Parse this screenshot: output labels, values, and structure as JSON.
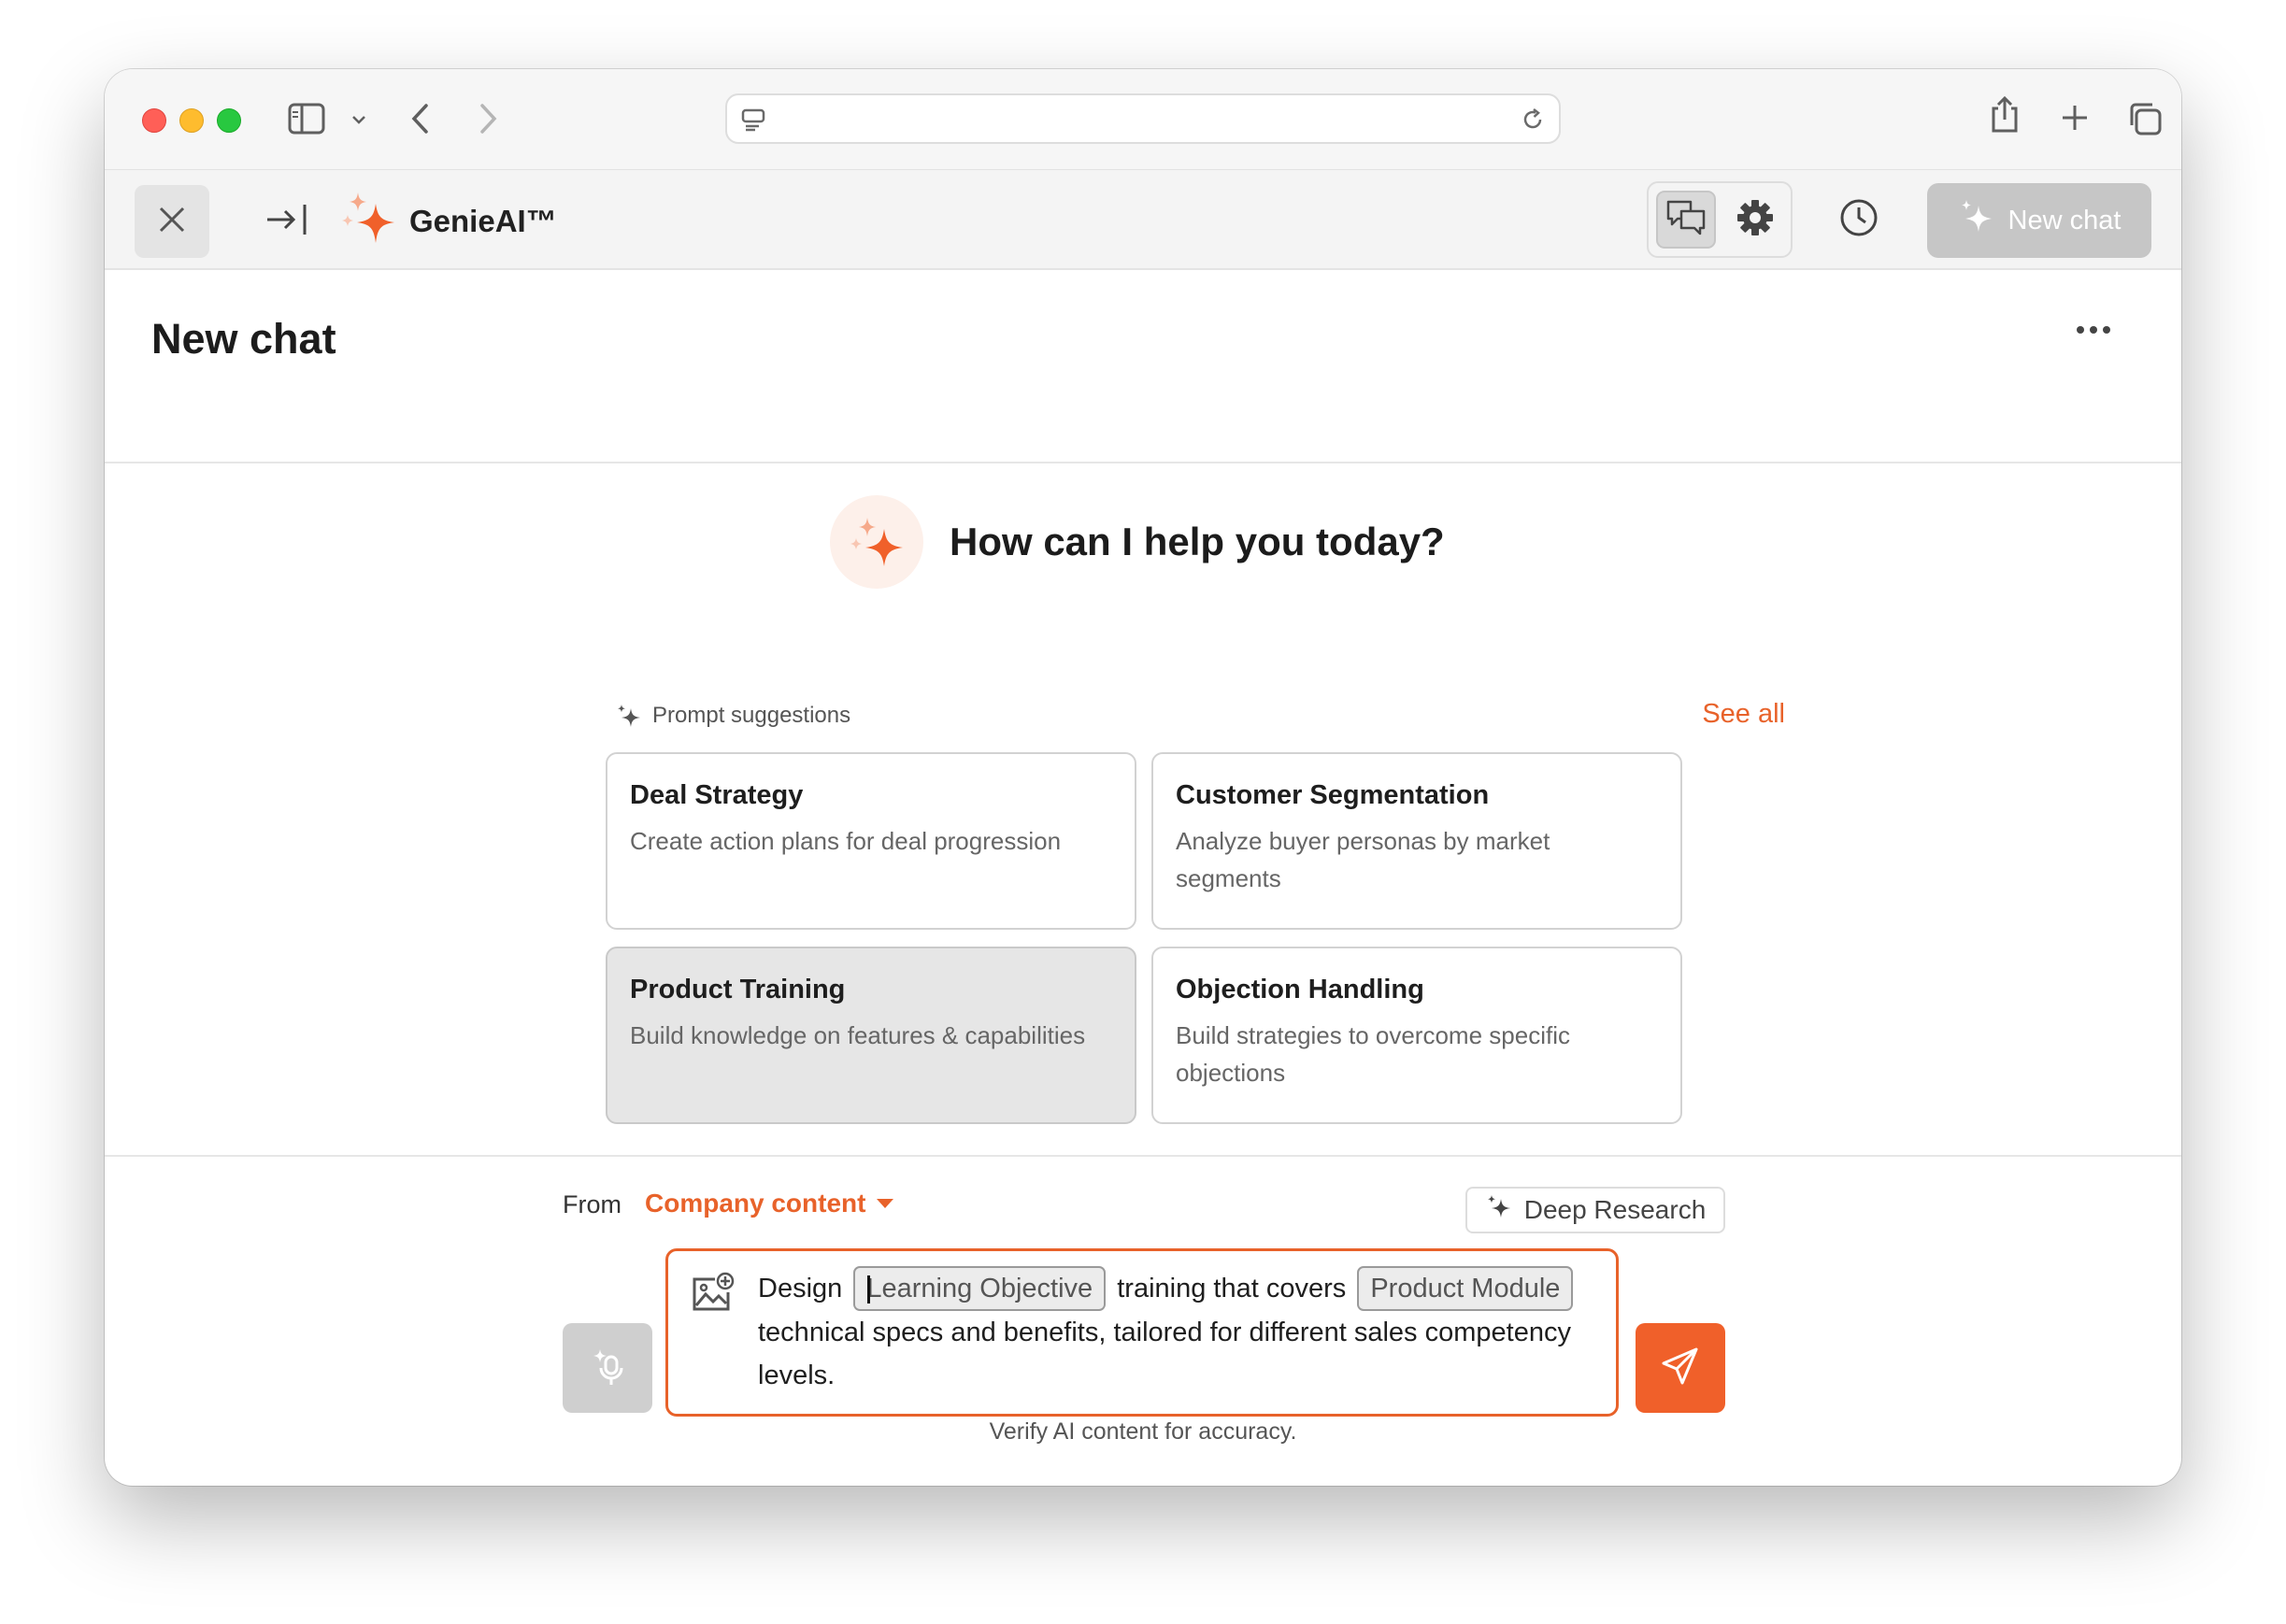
{
  "app": {
    "brand_name": "GenieAI™",
    "accent_color": "#e8622a",
    "new_chat_label": "New chat"
  },
  "page": {
    "title": "New chat",
    "hero_text": "How can I help you today?"
  },
  "suggestions": {
    "label": "Prompt suggestions",
    "see_all": "See all",
    "cards": [
      {
        "title": "Deal Strategy",
        "desc": "Create action plans for deal progression"
      },
      {
        "title": "Customer Segmentation",
        "desc": "Analyze buyer personas by market segments"
      },
      {
        "title": "Product Training",
        "desc": "Build knowledge on features & capabilities",
        "selected": true
      },
      {
        "title": "Objection Handling",
        "desc": "Build strategies to overcome specific objections"
      }
    ]
  },
  "composer": {
    "from_label": "From",
    "source_value": "Company content",
    "deep_research": "Deep Research",
    "prompt": {
      "part1": "Design",
      "chip1": "Learning Objective",
      "part2": "training that covers",
      "chip2": "Product Module",
      "part3": "technical specs and benefits, tailored for different sales competency levels."
    },
    "disclaimer": "Verify AI content for accuracy."
  },
  "icons": {
    "close": "close-icon",
    "collapse": "collapse-panel-icon",
    "chat": "chat-bubbles-icon",
    "settings": "gear-icon",
    "history": "clock-icon",
    "sparkle": "sparkle-icon",
    "attach": "image-add-icon",
    "mic": "voice-icon",
    "send": "send-icon"
  }
}
